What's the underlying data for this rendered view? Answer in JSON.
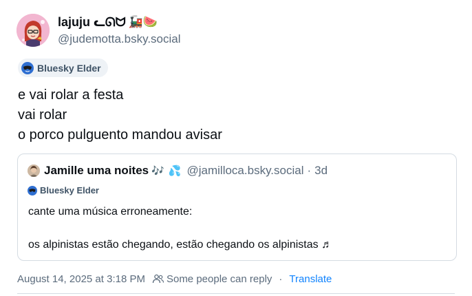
{
  "author": {
    "display_name": "lajuju ᓚᘏᗢ",
    "name_emojis": "🚂🍉",
    "handle": "@judemotta.bsky.social",
    "avatar_icon": "cartoon-girl-avatar"
  },
  "badge": {
    "label": "Bluesky Elder",
    "icon": "butterfly-sunglasses-icon"
  },
  "post": {
    "lines": [
      "e vai rolar a festa",
      "vai rolar",
      "o porco pulguento mandou avisar"
    ]
  },
  "quote": {
    "author_name": "Jamille uma noites",
    "emoji_1": "🎶",
    "emoji_2": "💦",
    "handle": "@jamilloca.bsky.social",
    "separator": "·",
    "time": "3d",
    "badge_label": "Bluesky Elder",
    "text_line_1": "cante uma música erroneamente:",
    "text_line_2": "os alpinistas estão chegando, estão chegando os alpinistas ♬"
  },
  "footer": {
    "timestamp": "August 14, 2025 at 3:18 PM",
    "reply_setting": "Some people can reply",
    "separator": "·",
    "translate_label": "Translate"
  },
  "colors": {
    "text": "#0b0f14",
    "muted": "#5b6b7c",
    "link": "#1083fe",
    "border": "#d4dbe2",
    "badge_bg": "#eef2f6"
  }
}
